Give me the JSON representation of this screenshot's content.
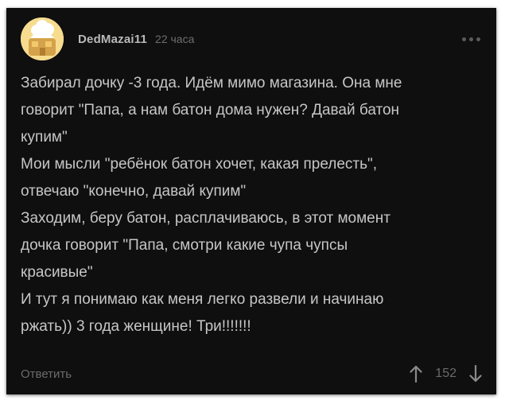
{
  "comment": {
    "author": "DedMazai11",
    "time": "22 часа",
    "lines": [
      "Забирал дочку -3 года. Идём мимо магазина. Она мне",
      "говорит \"Папа, а нам батон дома нужен? Давай батон",
      "купим\"",
      "Мои мысли \"ребёнок батон хочет, какая прелесть\",",
      "отвечаю \"конечно, давай купим\"",
      "Заходим, беру батон, расплачиваюсь, в этот момент",
      "дочка говорит \"Папа, смотри какие чупа чупсы",
      "красивые\"",
      "И тут я понимаю как меня легко развели и начинаю",
      "ржать)) 3 года женщине! Три!!!!!!!"
    ],
    "reply_label": "Ответить",
    "vote_count": "152"
  },
  "icons": {
    "avatar": "avatar-image",
    "more": "more-dots-icon",
    "upvote": "arrow-up-icon",
    "downvote": "arrow-down-icon"
  },
  "colors": {
    "background": "#0f0f0f",
    "text": "#c6c6c6",
    "muted": "#6b6b6b"
  }
}
